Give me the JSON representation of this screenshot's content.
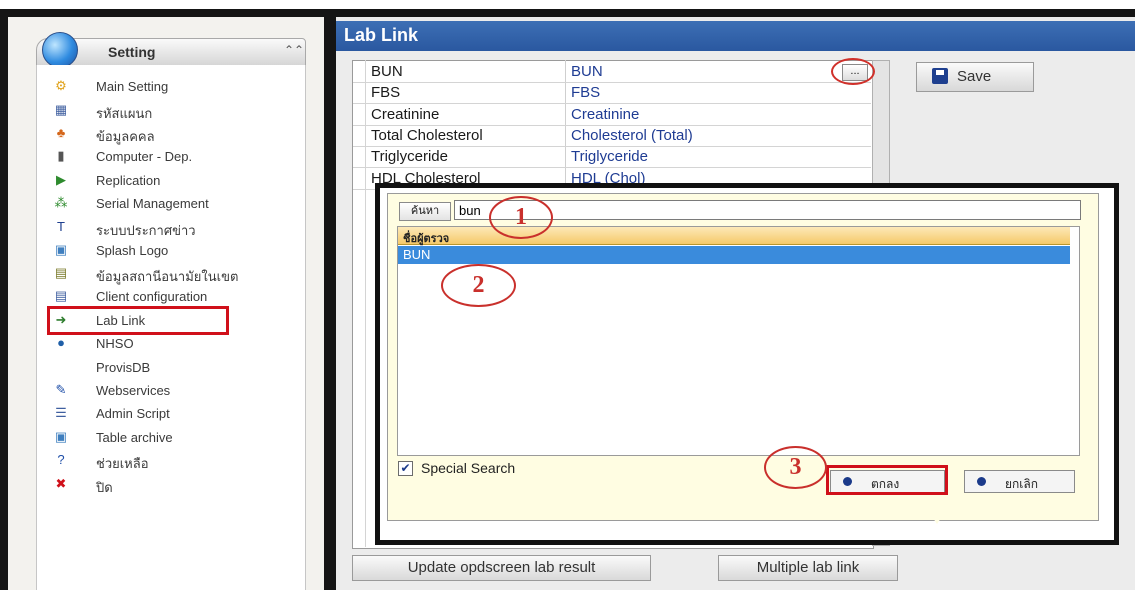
{
  "app": {
    "title": "Lab Link"
  },
  "sidebar": {
    "header": {
      "label": "Setting",
      "collapse_glyph": "⌃⌃"
    },
    "items": [
      {
        "label": "Main Setting",
        "icon": "wrench-icon",
        "glyph": "⚙",
        "color": "#e0a21a"
      },
      {
        "label": "รหัสแผนก",
        "icon": "grid-icon",
        "glyph": "▦",
        "color": "#3f5fa0"
      },
      {
        "label": "ข้อมูลคคล",
        "icon": "users-icon",
        "glyph": "♣",
        "color": "#d4661a"
      },
      {
        "label": "Computer - Dep.",
        "icon": "computer-icon",
        "glyph": "▮",
        "color": "#555555"
      },
      {
        "label": "Replication",
        "icon": "play-icon",
        "glyph": "▶",
        "color": "#2e8b2e"
      },
      {
        "label": "Serial Management",
        "icon": "serial-icon",
        "glyph": "⁂",
        "color": "#2e8b2e"
      },
      {
        "label": "ระบบประกาศข่าว",
        "icon": "news-icon",
        "glyph": "T",
        "color": "#1e3f8f"
      },
      {
        "label": "Splash Logo",
        "icon": "image-icon",
        "glyph": "▣",
        "color": "#3f7fbf"
      },
      {
        "label": "ข้อมูลสถานีอนามัยในเขต",
        "icon": "table-icon",
        "glyph": "▤",
        "color": "#7a7a2a"
      },
      {
        "label": "Client configuration",
        "icon": "config-icon",
        "glyph": "▤",
        "color": "#3f5fa0"
      },
      {
        "label": "Lab Link",
        "icon": "lab-link-icon",
        "glyph": "➜",
        "color": "#2e7d2e"
      },
      {
        "label": "NHSO",
        "icon": "globe-icon",
        "glyph": "●",
        "color": "#1f5fa8"
      },
      {
        "label": "ProvisDB",
        "icon": "",
        "glyph": "",
        "color": "#000000"
      },
      {
        "label": "Webservices",
        "icon": "webservices-icon",
        "glyph": "✎",
        "color": "#1f4fa8"
      },
      {
        "label": "Admin Script",
        "icon": "script-icon",
        "glyph": "☰",
        "color": "#3f5fa0"
      },
      {
        "label": "Table archive",
        "icon": "archive-icon",
        "glyph": "▣",
        "color": "#3f7fbf"
      },
      {
        "label": "ช่วยเหลือ",
        "icon": "help-icon",
        "glyph": "?",
        "color": "#1f4fa8"
      },
      {
        "label": "ปิด",
        "icon": "close-icon",
        "glyph": "✖",
        "color": "#d0101a"
      }
    ],
    "highlighted_item": "Lab Link"
  },
  "grid": {
    "rows": [
      {
        "name": "BUN",
        "mapped": "BUN"
      },
      {
        "name": "FBS",
        "mapped": "FBS"
      },
      {
        "name": "Creatinine",
        "mapped": "Creatinine"
      },
      {
        "name": "Total Cholesterol",
        "mapped": "Cholesterol (Total)"
      },
      {
        "name": "Triglyceride",
        "mapped": "Triglyceride"
      },
      {
        "name": "HDL Cholesterol",
        "mapped": "HDL (Chol)"
      }
    ],
    "ellipsis_label": "..."
  },
  "toolbar": {
    "save_label": "Save"
  },
  "footer": {
    "update_label": "Update opdscreen lab result",
    "multiple_label": "Multiple lab link"
  },
  "popup": {
    "search_label": "ค้นหา",
    "search_value": "bun",
    "list_header": "ชื่อผู้ตรวจ",
    "list_items": [
      "BUN"
    ],
    "special_search_label": "Special Search",
    "special_search_checked": true,
    "ok_label": "ตกลง",
    "cancel_label": "ยกเลิก"
  },
  "annotations": [
    "1",
    "2",
    "3"
  ],
  "colors": {
    "titlebar": "#2f5fa7",
    "highlight": "#d0101a",
    "selection": "#3a8bdc",
    "popup_bg": "#fffde2"
  }
}
